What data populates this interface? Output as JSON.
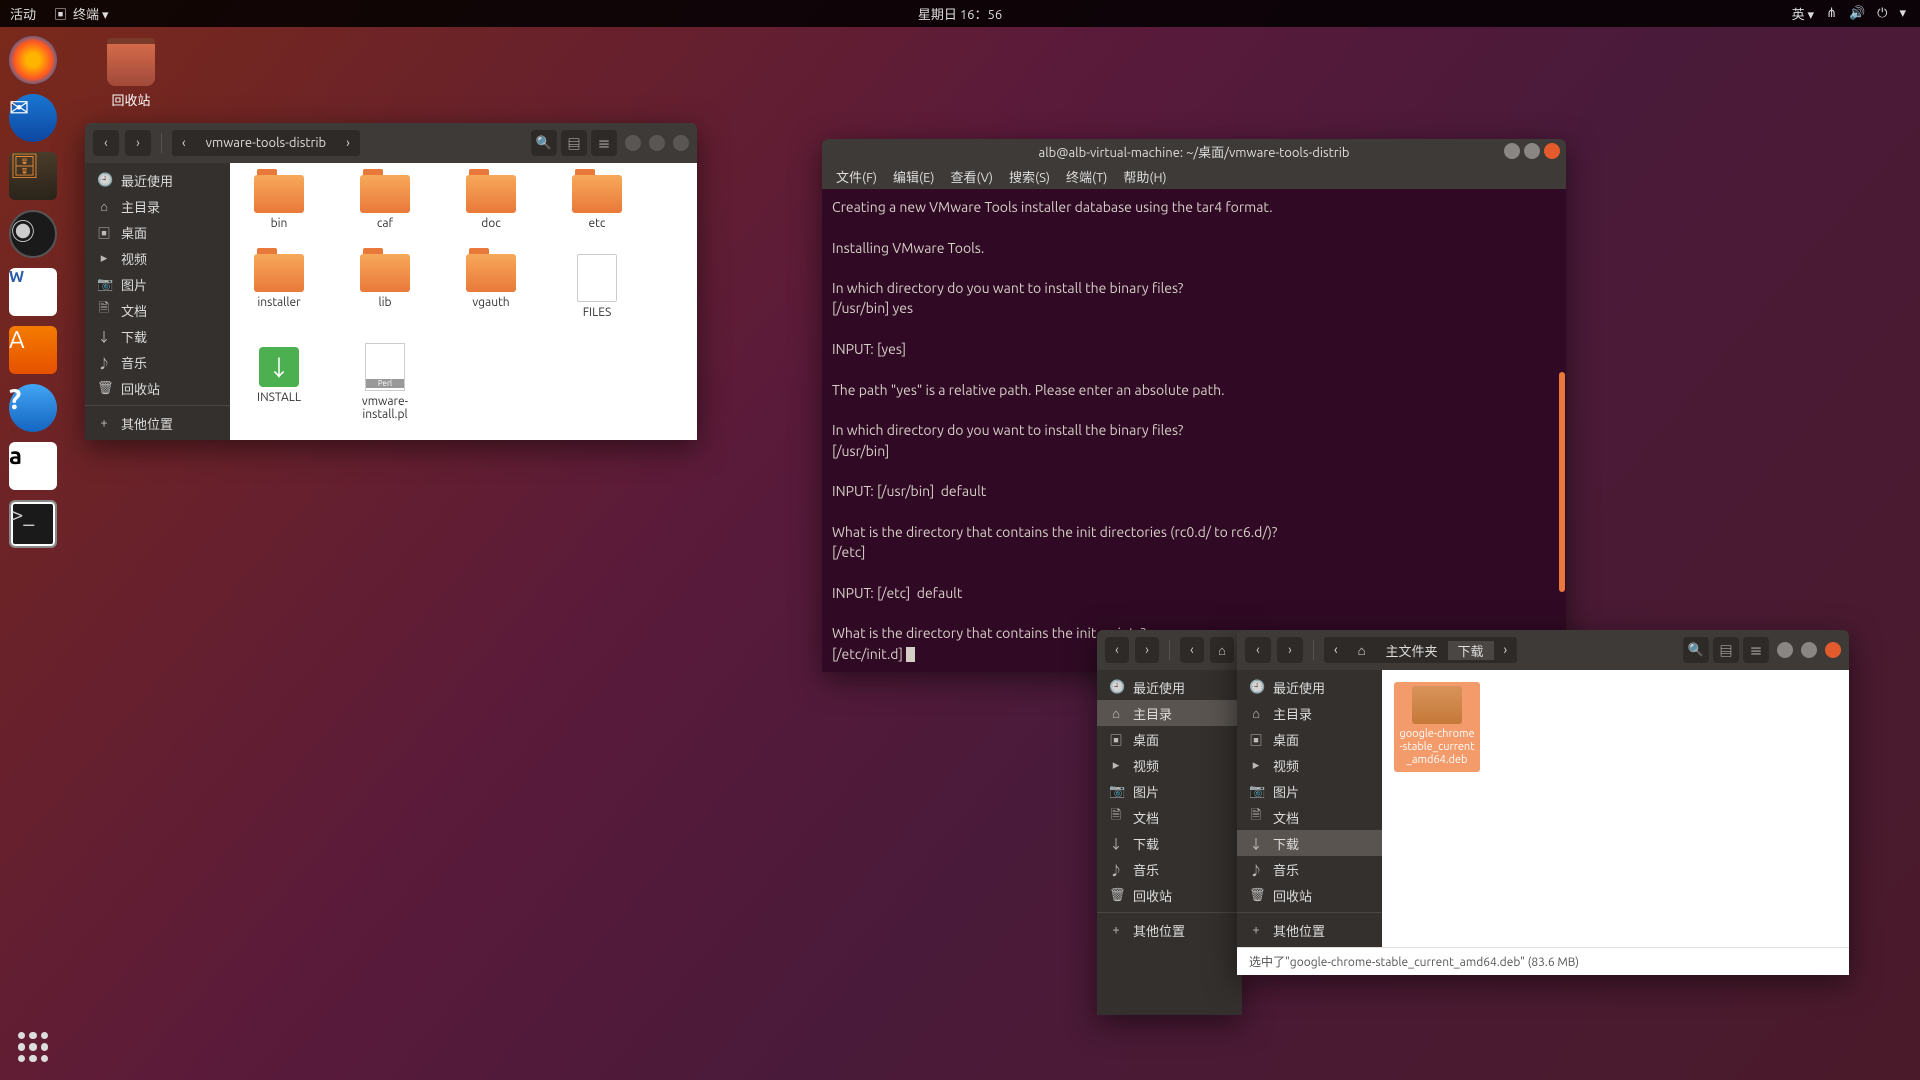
{
  "topbar": {
    "activities": "活动",
    "app_indicator": "终端 ▾",
    "datetime": "星期日 16：56",
    "ime": "英 ▾"
  },
  "desktop": {
    "trash_label": "回收站"
  },
  "nautilus1": {
    "path_segment": "vmware-tools-distrib",
    "sidebar": [
      "最近使用",
      "主目录",
      "桌面",
      "视频",
      "图片",
      "文档",
      "下载",
      "音乐",
      "回收站",
      "其他位置"
    ],
    "items": [
      {
        "n": "bin",
        "t": "folder"
      },
      {
        "n": "caf",
        "t": "folder"
      },
      {
        "n": "doc",
        "t": "folder"
      },
      {
        "n": "etc",
        "t": "folder"
      },
      {
        "n": "installer",
        "t": "folder"
      },
      {
        "n": "lib",
        "t": "folder"
      },
      {
        "n": "vgauth",
        "t": "folder"
      },
      {
        "n": "FILES",
        "t": "file"
      },
      {
        "n": "INSTALL",
        "t": "install"
      },
      {
        "n": "vmware-install.pl",
        "t": "perl"
      }
    ]
  },
  "terminal": {
    "title": "alb@alb-virtual-machine: ~/桌面/vmware-tools-distrib",
    "menus": [
      "文件(F)",
      "编辑(E)",
      "查看(V)",
      "搜索(S)",
      "终端(T)",
      "帮助(H)"
    ],
    "lines": [
      "Creating a new VMware Tools installer database using the tar4 format.",
      "",
      "Installing VMware Tools.",
      "",
      "In which directory do you want to install the binary files?",
      "[/usr/bin] yes",
      "",
      "INPUT: [yes]",
      "",
      "The path \"yes\" is a relative path. Please enter an absolute path.",
      "",
      "In which directory do you want to install the binary files?",
      "[/usr/bin]",
      "",
      "INPUT: [/usr/bin]  default",
      "",
      "What is the directory that contains the init directories (rc0.d/ to rc6.d/)?",
      "[/etc]",
      "",
      "INPUT: [/etc]  default",
      "",
      "What is the directory that contains the init scripts?",
      "[/etc/init.d] "
    ]
  },
  "nautilus2": {
    "crumb_home": "主文件夹",
    "crumb_current": "下载",
    "sidebar": [
      "最近使用",
      "主目录",
      "桌面",
      "视频",
      "图片",
      "文档",
      "下载",
      "音乐",
      "回收站",
      "其他位置"
    ],
    "file": "google-chrome-stable_current_amd64.deb",
    "status": "选中了\"google-chrome-stable_current_amd64.deb\" (83.6 MB)"
  }
}
